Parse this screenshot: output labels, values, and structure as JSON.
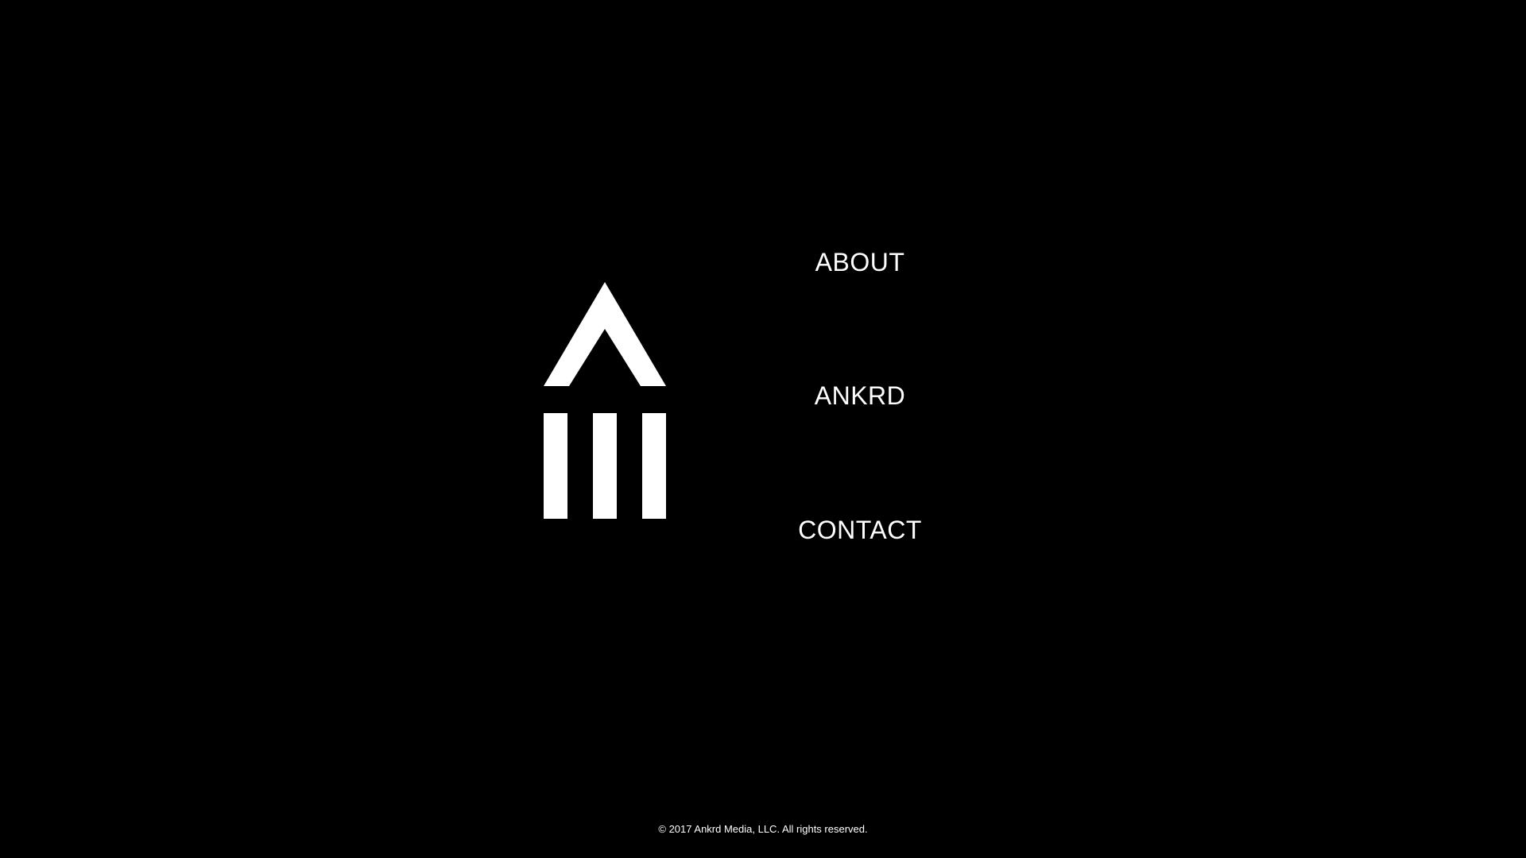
{
  "theme": {
    "background": "#000000",
    "foreground": "#ffffff"
  },
  "logo": {
    "icon": "ankrd-logo-icon"
  },
  "nav": {
    "items": [
      {
        "label": "ABOUT"
      },
      {
        "label": "ANKRD"
      },
      {
        "label": "CONTACT"
      }
    ]
  },
  "footer": {
    "copyright": "© 2017 Ankrd Media, LLC. All rights reserved."
  }
}
